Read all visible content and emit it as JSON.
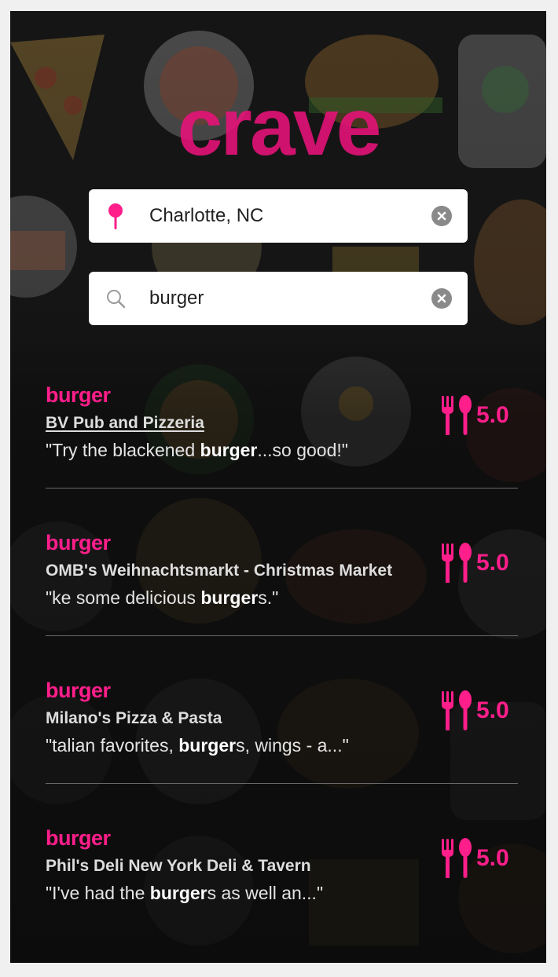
{
  "app": {
    "logo_text": "crave",
    "brand_color": "#e8127a"
  },
  "location": {
    "icon": "map-pin-icon",
    "value": "Charlotte, NC",
    "clear_icon": "clear-icon"
  },
  "search": {
    "icon": "search-icon",
    "value": "burger",
    "clear_icon": "clear-icon"
  },
  "results": [
    {
      "category": "burger",
      "name": "BV Pub and Pizzeria",
      "snippet_before": "\"Try the blackened ",
      "snippet_bold": "burger",
      "snippet_after": "...so good!\"",
      "rating_icon": "fork-spoon-icon",
      "score": "5.0"
    },
    {
      "category": "burger",
      "name": "OMB's Weihnachtsmarkt - Christmas Market",
      "snippet_before": "\"ke some delicious ",
      "snippet_bold": "burger",
      "snippet_after": "s.\"",
      "rating_icon": "fork-spoon-icon",
      "score": "5.0"
    },
    {
      "category": "burger",
      "name": "Milano's Pizza & Pasta",
      "snippet_before": "\"talian favorites, ",
      "snippet_bold": "burger",
      "snippet_after": "s, wings - a...\"",
      "rating_icon": "fork-spoon-icon",
      "score": "5.0"
    },
    {
      "category": "burger",
      "name": "Phil's Deli New York Deli & Tavern",
      "snippet_before": "\"I've had the ",
      "snippet_bold": "burger",
      "snippet_after": "s as well an...\"",
      "rating_icon": "fork-spoon-icon",
      "score": "5.0"
    }
  ]
}
